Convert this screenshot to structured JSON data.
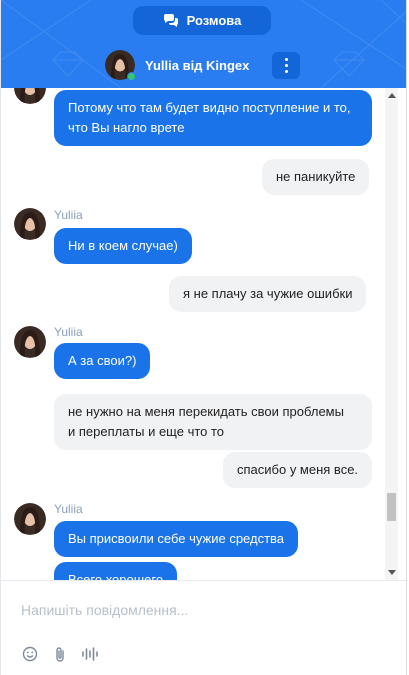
{
  "header": {
    "tab_label": "Розмова",
    "agent_name": "Yullia від Kingex",
    "accent": "#2a7df0"
  },
  "messages": [
    {
      "from": "agent",
      "text_lines": [
        "Потому что там будет видно поступление и то,",
        "что Вы нагло врете"
      ]
    },
    {
      "from": "user",
      "text": "не паникуйте"
    },
    {
      "from": "agent",
      "sender": "Yuliia",
      "text": "Ни в коем случае)"
    },
    {
      "from": "user",
      "text": "я не плачу за чужие ошибки"
    },
    {
      "from": "agent",
      "sender": "Yuliia",
      "text": "А за свои?)"
    },
    {
      "from": "user",
      "text_lines": [
        "не нужно на меня перекидать свои проблемы",
        "и переплаты и еще что то"
      ]
    },
    {
      "from": "user",
      "text": "спасибо у меня все."
    },
    {
      "from": "agent",
      "sender": "Yuliia",
      "text": "Вы присвоили себе чужие средства"
    },
    {
      "from": "agent",
      "text": "Всего хорошего"
    }
  ],
  "composer": {
    "placeholder": "Напишіть повідомлення...",
    "tools": [
      "emoji-icon",
      "attachment-icon",
      "voice-icon"
    ]
  }
}
